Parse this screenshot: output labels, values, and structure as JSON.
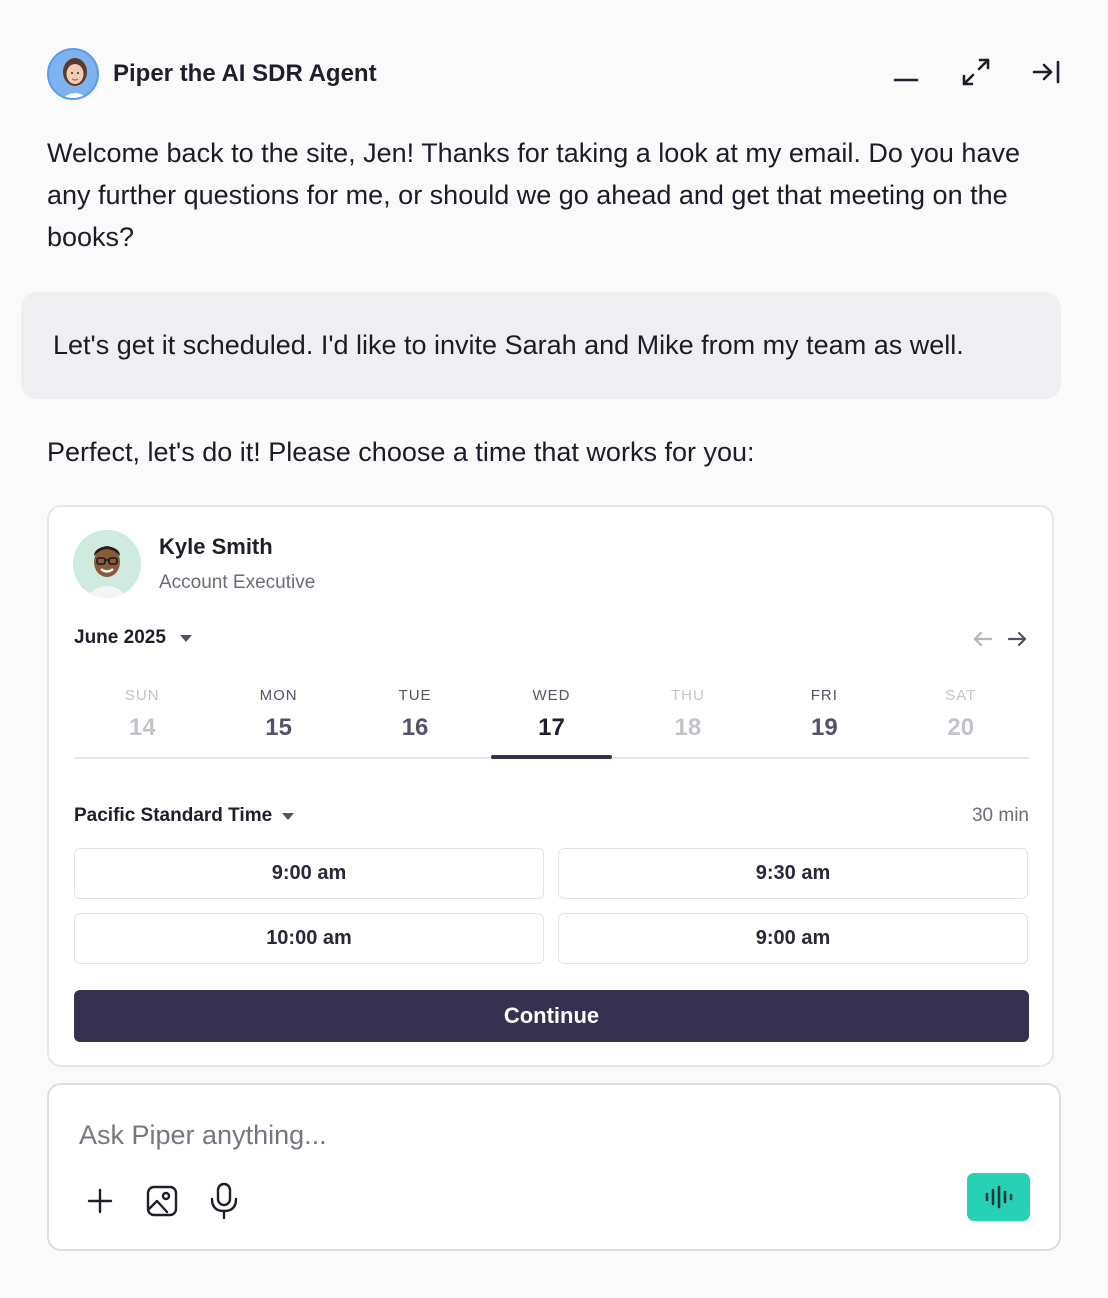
{
  "header": {
    "agent_name": "Piper the AI SDR Agent",
    "icons": [
      "minimize-icon",
      "expand-icon",
      "collapse-panel-icon"
    ]
  },
  "messages": {
    "agent_greeting": "Welcome back to the site, Jen! Thanks for taking a look at my email. Do you have any further questions for me, or should we go ahead and get that meeting on the books?",
    "user_reply": "Let's get it scheduled. I'd like to invite Sarah and Mike from my team as well.",
    "agent_prompt": "Perfect, let's do it! Please choose a time that works for you:"
  },
  "scheduler": {
    "rep_name": "Kyle Smith",
    "rep_title": "Account Executive",
    "month": "June 2025",
    "days": [
      {
        "dow": "SUN",
        "num": "14",
        "state": "disabled"
      },
      {
        "dow": "MON",
        "num": "15",
        "state": "available"
      },
      {
        "dow": "TUE",
        "num": "16",
        "state": "available"
      },
      {
        "dow": "WED",
        "num": "17",
        "state": "selected"
      },
      {
        "dow": "THU",
        "num": "18",
        "state": "disabled"
      },
      {
        "dow": "FRI",
        "num": "19",
        "state": "available"
      },
      {
        "dow": "SAT",
        "num": "20",
        "state": "disabled"
      }
    ],
    "timezone": "Pacific Standard Time",
    "duration": "30 min",
    "slots": [
      "9:00 am",
      "9:30 am",
      "10:00 am",
      "9:00 am"
    ],
    "continue_label": "Continue"
  },
  "composer": {
    "placeholder": "Ask Piper anything...",
    "value": ""
  },
  "colors": {
    "primary_button": "#363151",
    "voice_button": "#26d1b5",
    "user_bubble": "#efeef1"
  }
}
